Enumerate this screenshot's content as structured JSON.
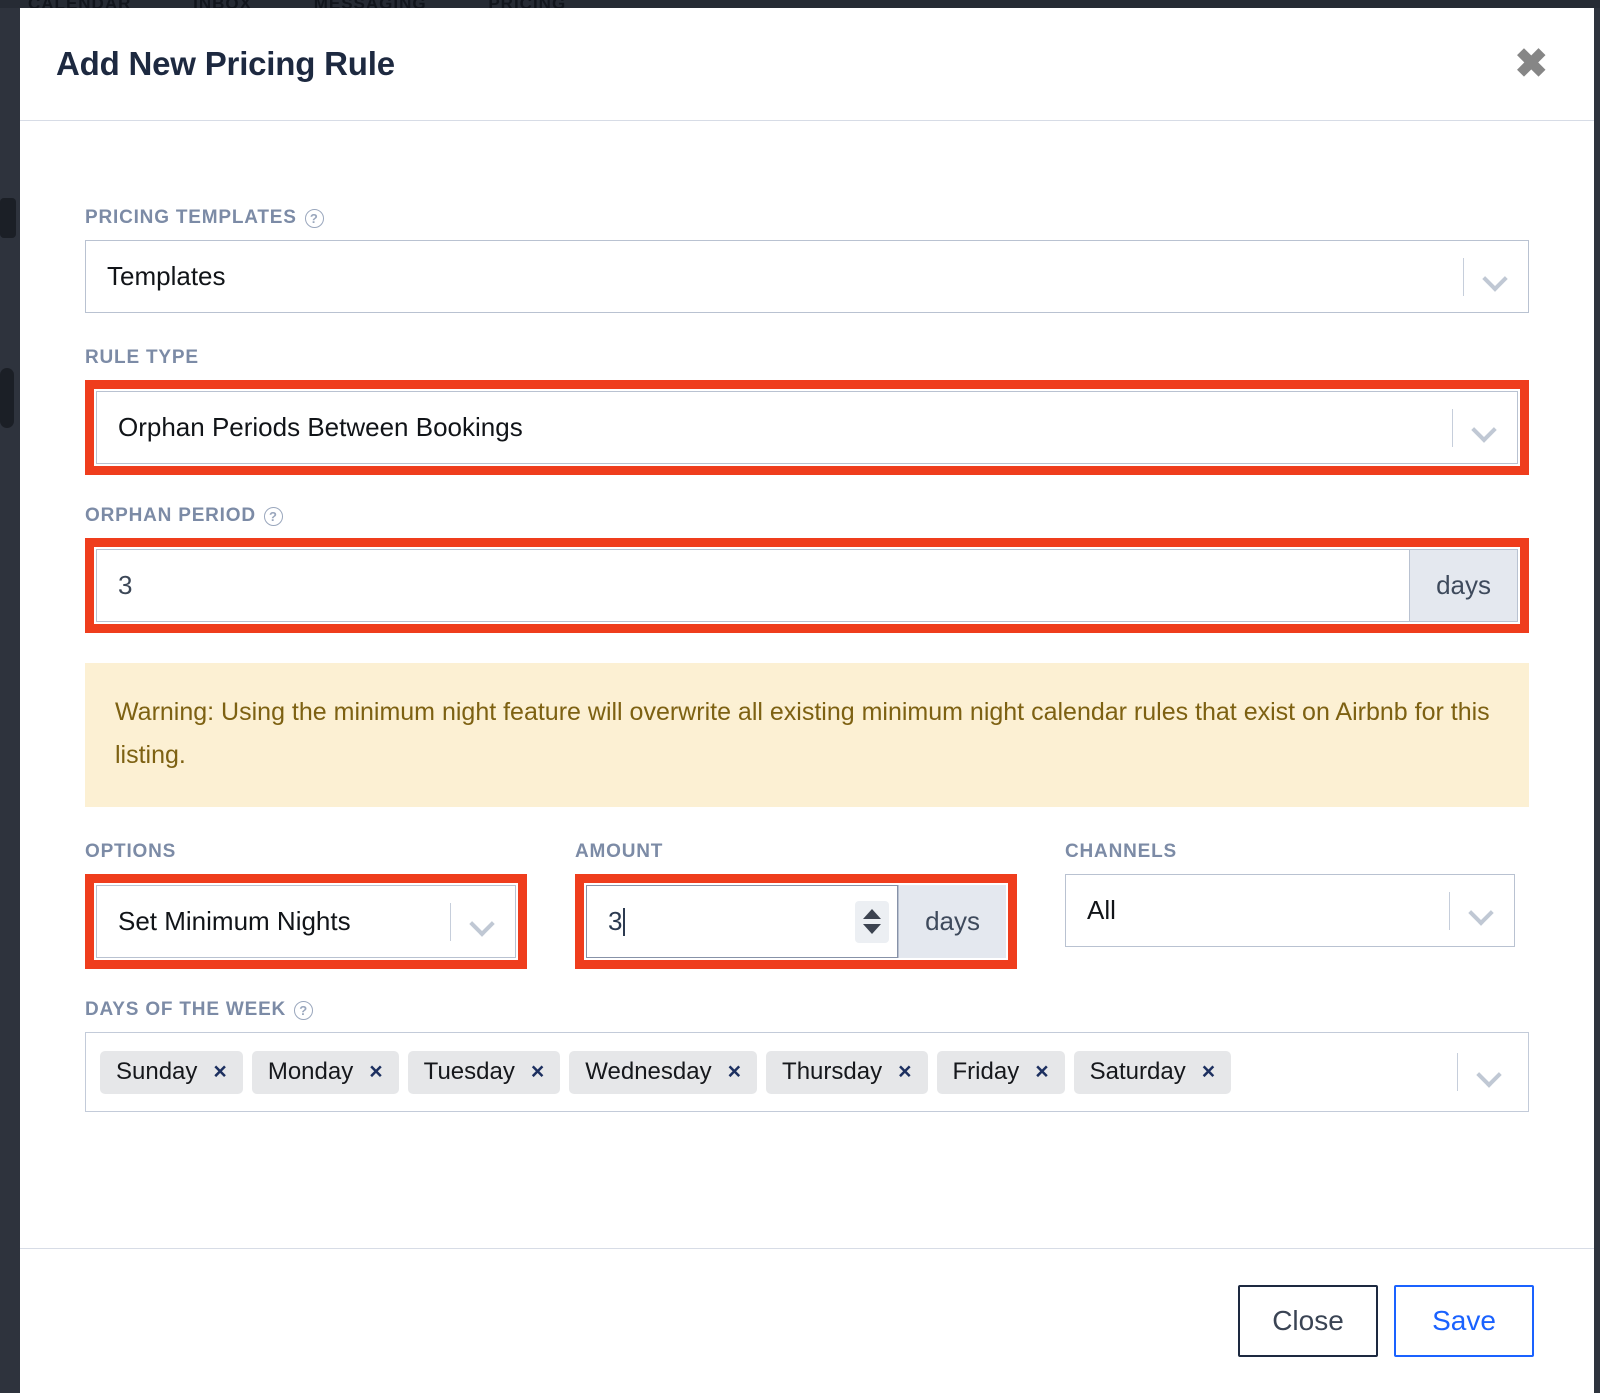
{
  "backdrop": {
    "nav_items": [
      "CALENDAR",
      "INBOX",
      "MESSAGING",
      "PRICING"
    ]
  },
  "modal": {
    "title": "Add New Pricing Rule",
    "close_icon": "close-icon",
    "close_glyph": "✖"
  },
  "fields": {
    "pricing_templates": {
      "label": "PRICING TEMPLATES",
      "help_glyph": "?",
      "value": "Templates",
      "chevron_icon": "chevron-down-icon",
      "highlighted": false
    },
    "rule_type": {
      "label": "RULE TYPE",
      "value": "Orphan Periods Between Bookings",
      "chevron_icon": "chevron-down-icon",
      "highlighted": true
    },
    "orphan_period": {
      "label": "ORPHAN PERIOD",
      "help_glyph": "?",
      "value": "3",
      "suffix": "days",
      "highlighted": true
    },
    "options": {
      "label": "OPTIONS",
      "value": "Set Minimum Nights",
      "chevron_icon": "chevron-down-icon",
      "highlighted": true
    },
    "amount": {
      "label": "AMOUNT",
      "value": "3",
      "suffix": "days",
      "spinner_icon": "number-spinner-icon",
      "highlighted": true,
      "focused": true
    },
    "channels": {
      "label": "CHANNELS",
      "value": "All",
      "chevron_icon": "chevron-down-icon",
      "highlighted": false
    },
    "days_of_week": {
      "label": "DAYS OF THE WEEK",
      "help_glyph": "?",
      "chevron_icon": "chevron-down-icon",
      "remove_glyph": "×",
      "chips": [
        "Sunday",
        "Monday",
        "Tuesday",
        "Wednesday",
        "Thursday",
        "Friday",
        "Saturday"
      ]
    }
  },
  "warning": {
    "text": "Warning: Using the minimum night feature will overwrite all existing minimum night calendar rules that exist on Airbnb for this listing."
  },
  "footer": {
    "close_label": "Close",
    "save_label": "Save"
  },
  "colors": {
    "highlight_red": "#ef3d1d",
    "warning_bg": "#fcf0d3",
    "warning_text": "#7d6112",
    "label_slate": "#7c8ba6",
    "title_navy": "#1d2940",
    "save_blue": "#1a62ff"
  }
}
